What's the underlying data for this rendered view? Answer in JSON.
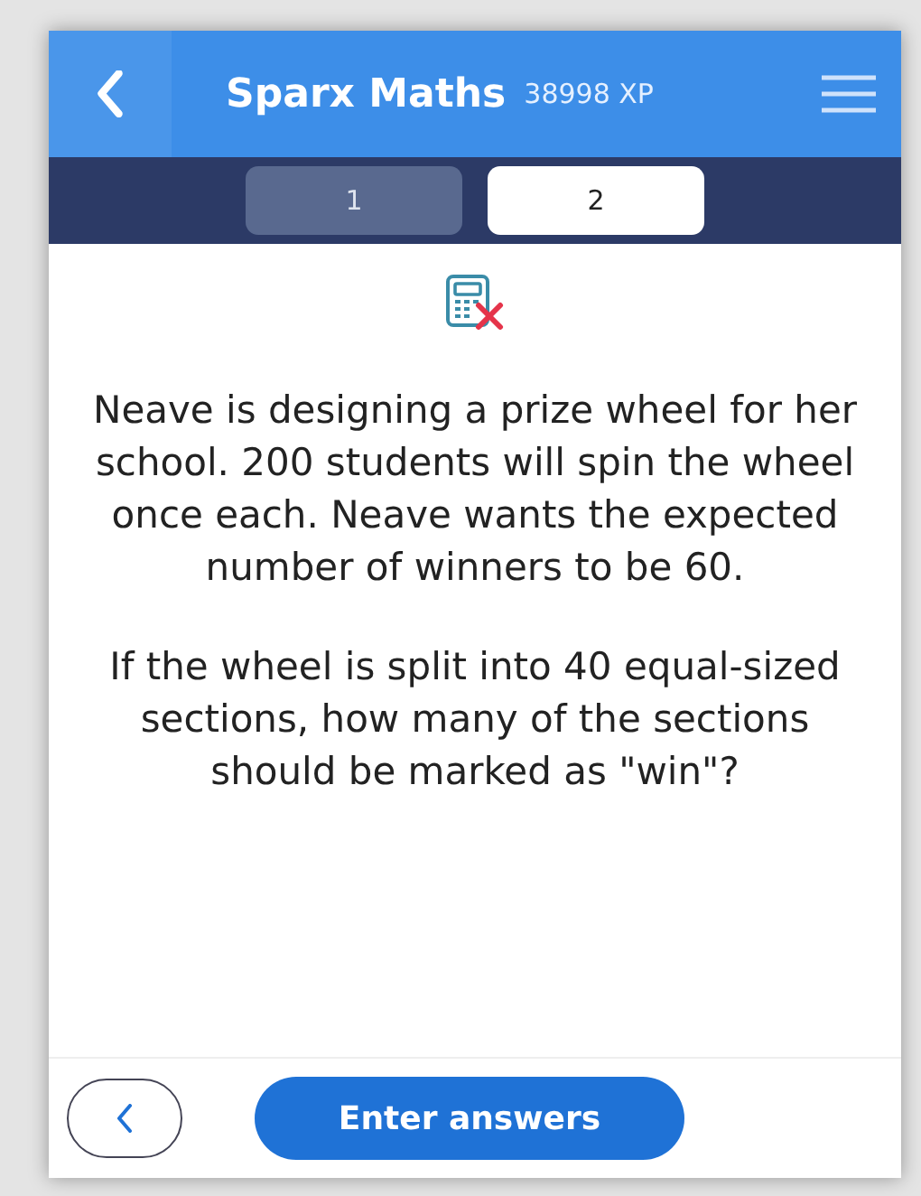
{
  "header": {
    "title": "Sparx Maths",
    "xp": "38998 XP"
  },
  "tabs": [
    {
      "label": "1",
      "selected": false
    },
    {
      "label": "2",
      "selected": true
    }
  ],
  "calculator_allowed": false,
  "question": [
    "Neave is designing a prize wheel for her school. 200 students will spin the wheel once each. Neave wants the expected number of winners to be 60.",
    "If the wheel is split into 40 equal-sized sections, how many of the sections should be marked as \"win\"?"
  ],
  "footer": {
    "button": "Enter answers"
  }
}
